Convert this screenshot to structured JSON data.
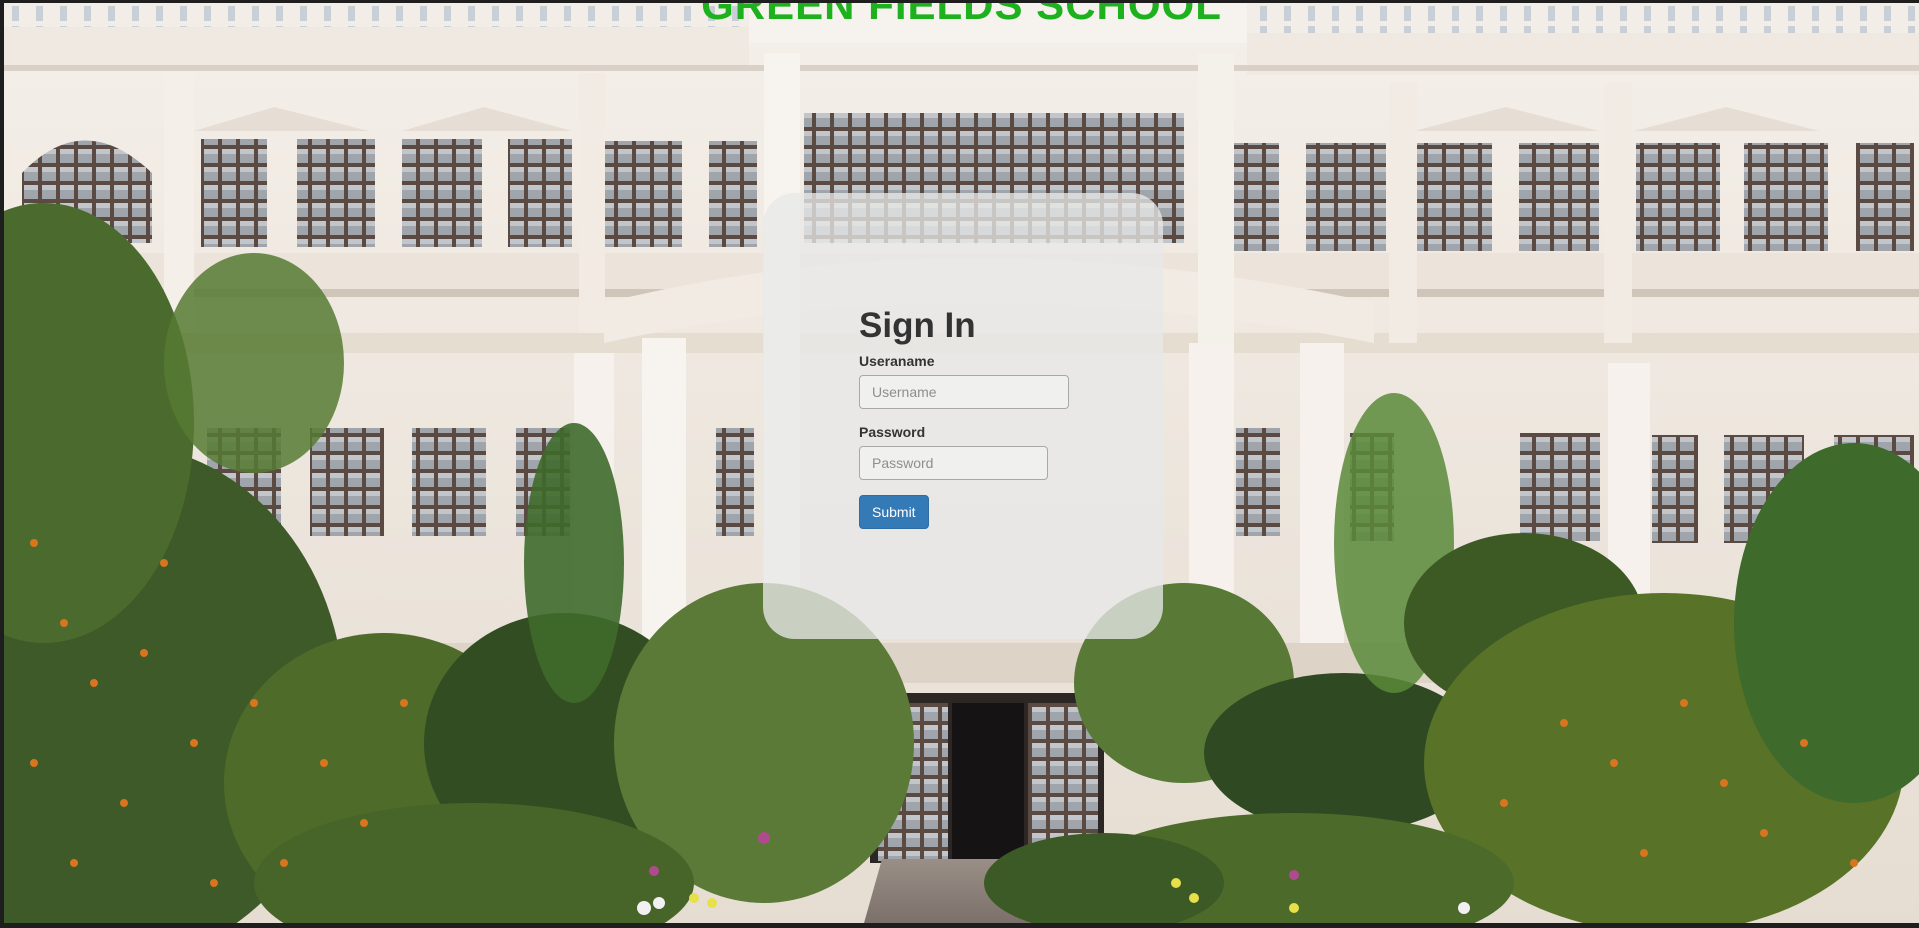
{
  "page": {
    "school_name": "GREEN FIELDS SCHOOL",
    "background_image": "school building facade with garden"
  },
  "login": {
    "title": "Sign In",
    "username_label": "Useraname",
    "username_placeholder": "Username",
    "username_value": "",
    "password_label": "Password",
    "password_placeholder": "Password",
    "password_value": "",
    "submit_label": "Submit"
  },
  "colors": {
    "school_name": "#1db21d",
    "submit_button": "#337ab7",
    "card_background": "rgba(232,232,232,0.78)"
  }
}
